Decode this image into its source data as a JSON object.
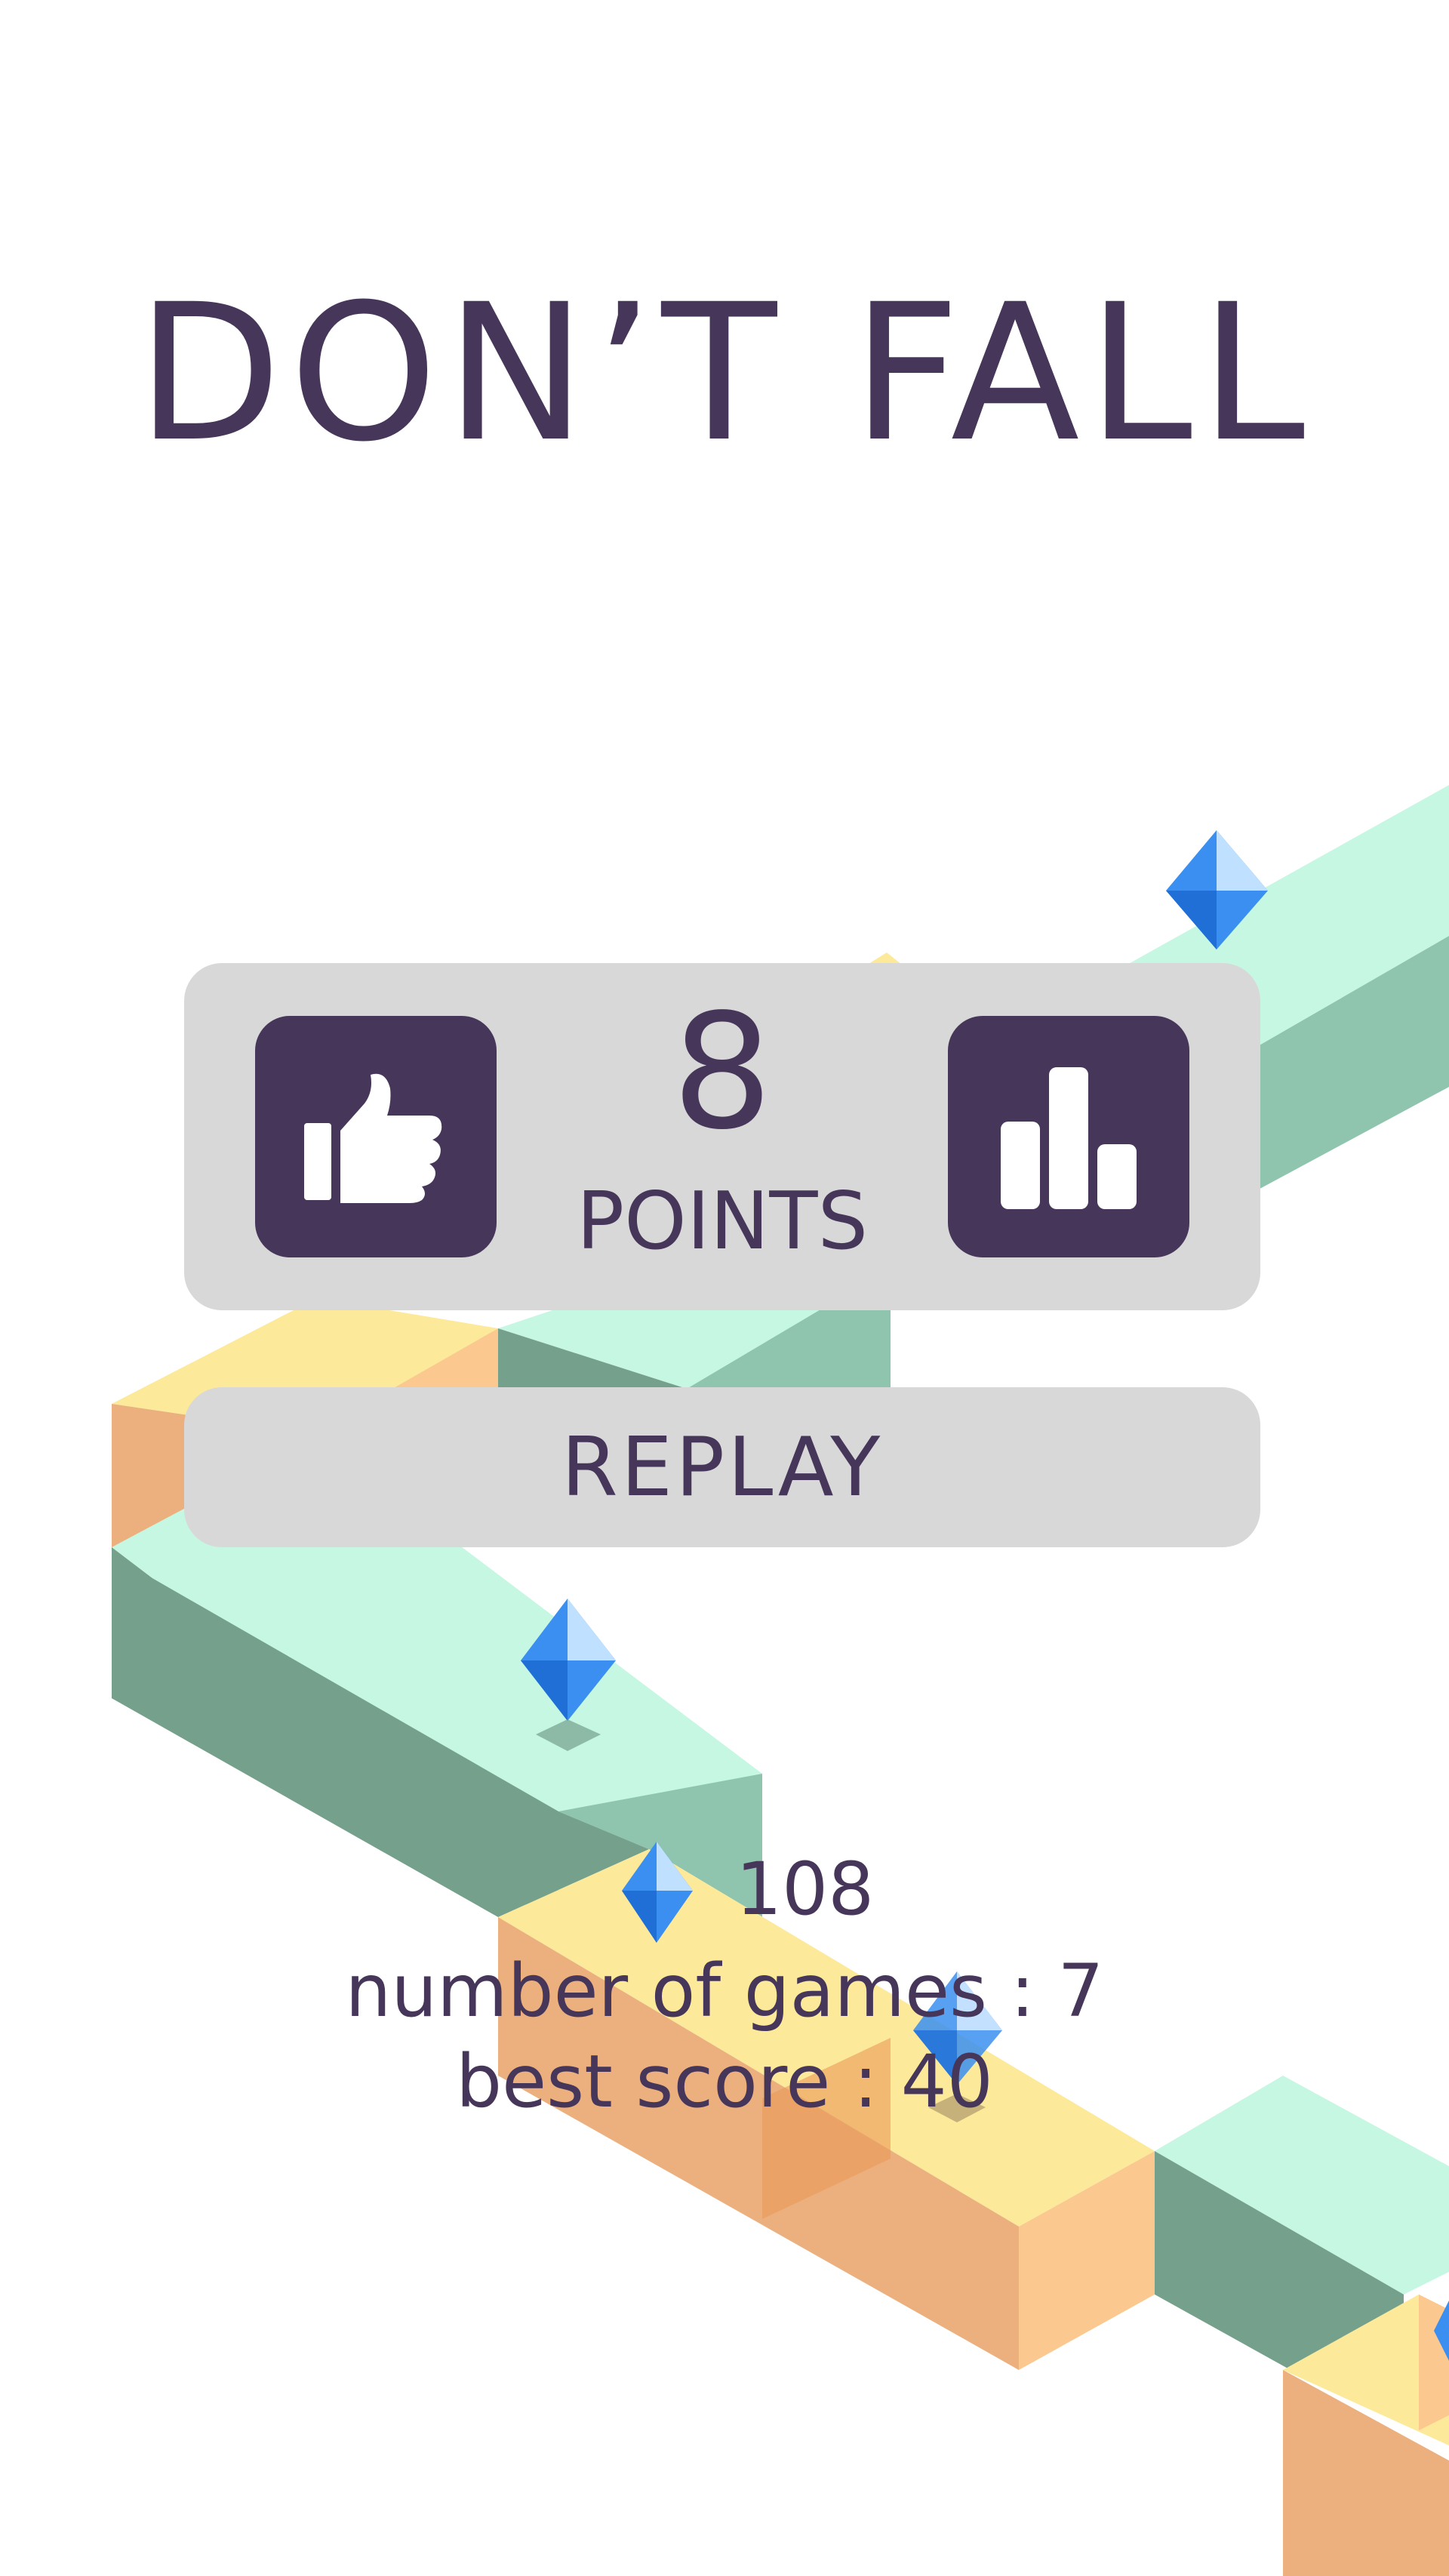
{
  "title": "DON’T FALL",
  "score": {
    "value": "8",
    "label": "POINTS"
  },
  "buttons": {
    "like_icon": "thumbs-up-icon",
    "leaderboard_icon": "leaderboard-icon",
    "replay_label": "REPLAY"
  },
  "stats": {
    "gem_count": "108",
    "games_label": "number of games :",
    "games_value": "7",
    "best_label": "best score :",
    "best_value": "40"
  },
  "colors": {
    "text": "#46365a",
    "panel": "#d8d8d8",
    "mint_top": "#c5f7e3",
    "mint_side": "#8fc5ae",
    "mint_dark": "#75a08b",
    "yellow_top": "#fde99a",
    "orange_side": "#ebb07e",
    "gem_blue": "#3a8ff0"
  }
}
